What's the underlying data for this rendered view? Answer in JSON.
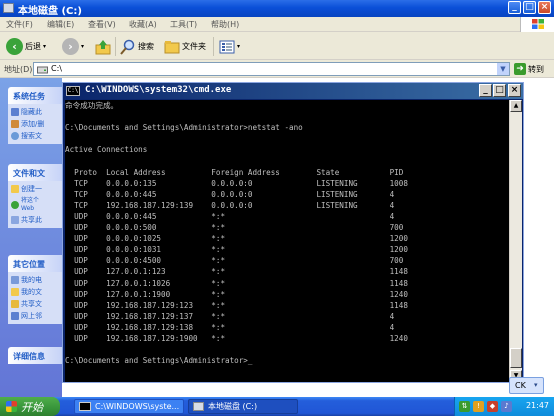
{
  "explorer": {
    "title": "本地磁盘 (C:)",
    "menu": [
      "文件(F)",
      "编辑(E)",
      "查看(V)",
      "收藏(A)",
      "工具(T)",
      "帮助(H)"
    ],
    "toolbar": {
      "back": "后退",
      "search": "搜索",
      "folders": "文件夹"
    },
    "address": {
      "label": "地址(D)",
      "value": "C:\\",
      "go": "转到"
    },
    "taskpane": {
      "system_tasks": {
        "title": "系统任务",
        "items": [
          "隐藏此",
          "添加/删",
          "搜索文"
        ]
      },
      "file_tasks": {
        "title": "文件和文",
        "items": [
          "创建一",
          "将这个 Web",
          "共享此"
        ]
      },
      "other_places": {
        "title": "其它位置",
        "items": [
          "我的电",
          "我的文",
          "共享文",
          "网上邻"
        ]
      },
      "details": {
        "title": "详细信息"
      }
    }
  },
  "cmd": {
    "title": "C:\\WINDOWS\\system32\\cmd.exe",
    "lines": [
      "命令成功完成。",
      "",
      "C:\\Documents and Settings\\Administrator>netstat -ano",
      "",
      "Active Connections",
      "",
      "  Proto  Local Address          Foreign Address        State           PID",
      "  TCP    0.0.0.0:135            0.0.0.0:0              LISTENING       1008",
      "  TCP    0.0.0.0:445            0.0.0.0:0              LISTENING       4",
      "  TCP    192.168.187.129:139    0.0.0.0:0              LISTENING       4",
      "  UDP    0.0.0.0:445            *:*                                    4",
      "  UDP    0.0.0.0:500            *:*                                    700",
      "  UDP    0.0.0.0:1025           *:*                                    1200",
      "  UDP    0.0.0.0:1031           *:*                                    1200",
      "  UDP    0.0.0.0:4500           *:*                                    700",
      "  UDP    127.0.0.1:123          *:*                                    1148",
      "  UDP    127.0.0.1:1026         *:*                                    1148",
      "  UDP    127.0.0.1:1900         *:*                                    1240",
      "  UDP    192.168.187.129:123    *:*                                    1148",
      "  UDP    192.168.187.129:137    *:*                                    4",
      "  UDP    192.168.187.129:138    *:*                                    4",
      "  UDP    192.168.187.129:1900   *:*                                    1240",
      "",
      "C:\\Documents and Settings\\Administrator>_"
    ]
  },
  "langbar": {
    "text": "CK"
  },
  "taskbar": {
    "start": "开始",
    "tasks": [
      {
        "label": "C:\\WINDOWS\\syste..."
      },
      {
        "label": "本地磁盘 (C:)"
      }
    ],
    "clock": "21:47"
  },
  "colors": {
    "xp_blue": "#0a4fd8",
    "taskbar": "#245edb",
    "start_green": "#37943a",
    "console_text": "#c0c0c0"
  }
}
